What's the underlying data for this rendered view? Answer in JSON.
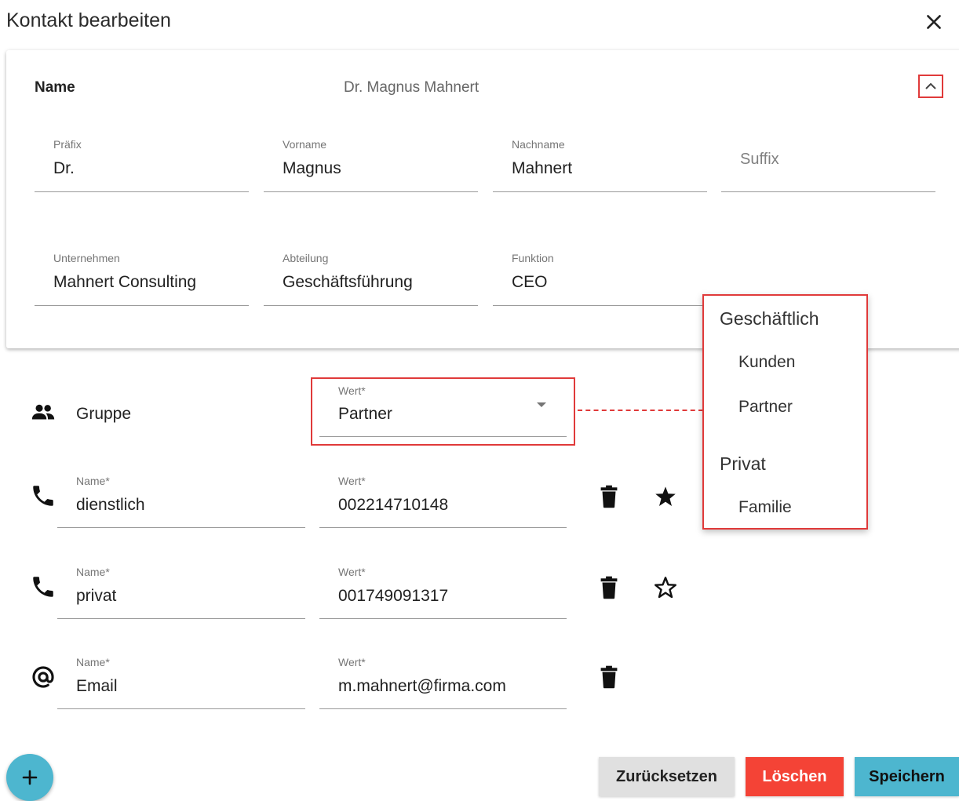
{
  "dialog": {
    "title": "Kontakt bearbeiten",
    "close_icon": "close-icon"
  },
  "name_card": {
    "label": "Name",
    "summary": "Dr. Magnus Mahnert",
    "collapse_icon": "chevron-up-icon",
    "fields": {
      "prefix": {
        "label": "Präfix",
        "value": "Dr."
      },
      "first_name": {
        "label": "Vorname",
        "value": "Magnus"
      },
      "last_name": {
        "label": "Nachname",
        "value": "Mahnert"
      },
      "suffix": {
        "placeholder": "Suffix"
      },
      "company": {
        "label": "Unternehmen",
        "value": "Mahnert Consulting"
      },
      "department": {
        "label": "Abteilung",
        "value": "Geschäftsführung"
      },
      "function": {
        "label": "Funktion",
        "value": "CEO"
      }
    }
  },
  "group_row": {
    "icon": "group-icon",
    "label": "Gruppe",
    "value_label": "Wert*",
    "value": "Partner"
  },
  "contact_rows": [
    {
      "icon": "phone-icon",
      "name_label": "Name*",
      "name": "dienstlich",
      "value_label": "Wert*",
      "value": "002214710148",
      "favorite": true
    },
    {
      "icon": "phone-icon",
      "name_label": "Name*",
      "name": "privat",
      "value_label": "Wert*",
      "value": "001749091317",
      "favorite": false
    },
    {
      "icon": "at-icon",
      "name_label": "Name*",
      "name": "Email",
      "value_label": "Wert*",
      "value": "m.mahnert@firma.com"
    }
  ],
  "group_menu": {
    "groups": [
      {
        "label": "Geschäftlich",
        "items": [
          "Kunden",
          "Partner"
        ]
      },
      {
        "label": "Privat",
        "items": [
          "Familie"
        ]
      }
    ]
  },
  "actions": {
    "reset": "Zurücksetzen",
    "delete": "Löschen",
    "save": "Speichern"
  },
  "colors": {
    "accent": "#4db6cf",
    "danger": "#f44336",
    "neutral": "#e0e0e0",
    "highlight": "#e03a3a"
  }
}
